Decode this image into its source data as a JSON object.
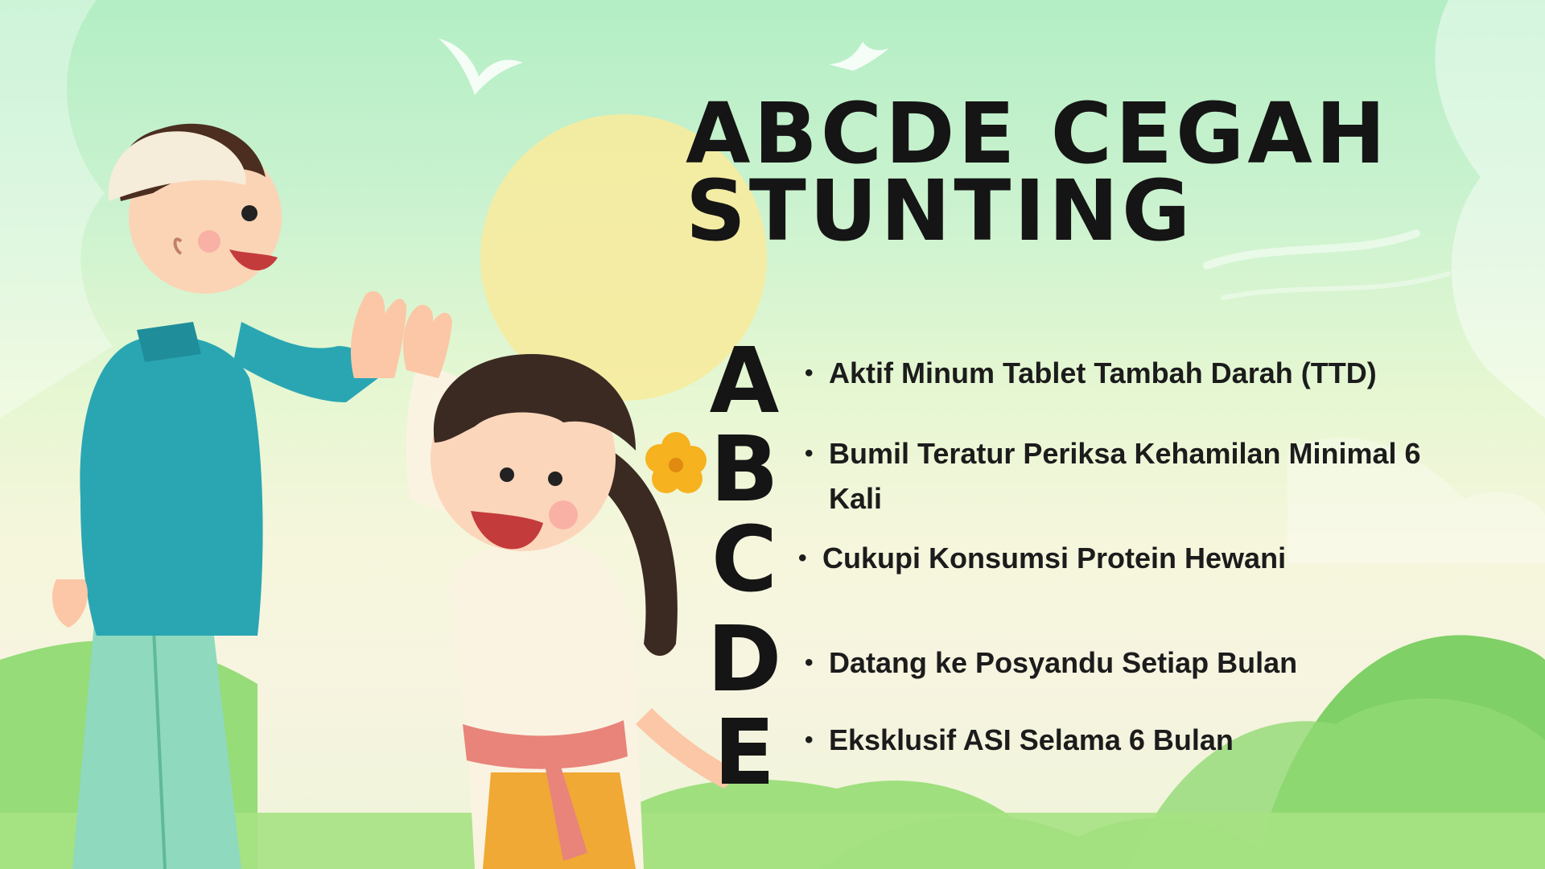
{
  "title": "ABCDE CEGAH STUNTING",
  "letters": [
    "A",
    "B",
    "C",
    "D",
    "E"
  ],
  "items": [
    "Aktif Minum Tablet Tambah Darah (TTD)",
    "Bumil Teratur Periksa Kehamilan Minimal 6 Kali",
    "Cukupi Konsumsi Protein Hewani",
    "Datang ke Posyandu Setiap Bulan",
    "Eksklusif ASI Selama 6 Bulan"
  ],
  "bullet": "•",
  "colors": {
    "sky_top": "#b3eec4",
    "sky_mid": "#f5f6dc",
    "sun": "#f7eb9e",
    "text": "#151515",
    "grass": "#8cd86a",
    "boy_shirt": "#2aa6b3",
    "boy_pants": "#8fd9be",
    "girl_sash": "#e8847a",
    "girl_flower": "#f6b21f"
  }
}
